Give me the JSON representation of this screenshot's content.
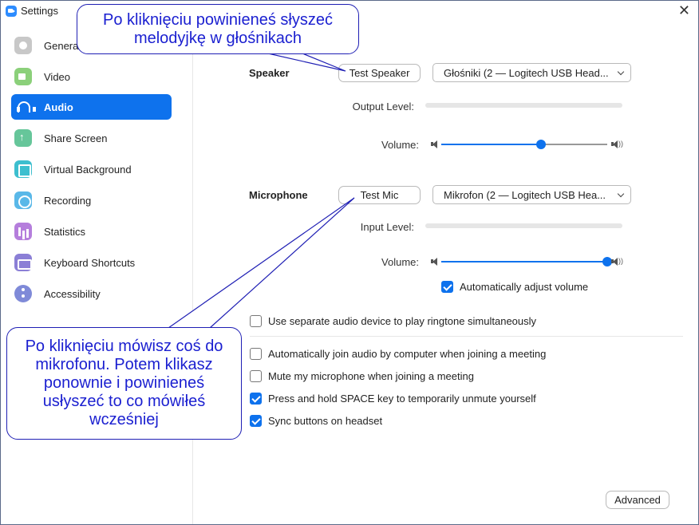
{
  "window": {
    "title": "Settings",
    "close": "✕"
  },
  "sidebar": {
    "items": [
      {
        "label": "General",
        "icon": "gear-icon"
      },
      {
        "label": "Video",
        "icon": "video-icon"
      },
      {
        "label": "Audio",
        "icon": "headphones-icon",
        "active": true
      },
      {
        "label": "Share Screen",
        "icon": "share-screen-icon"
      },
      {
        "label": "Virtual Background",
        "icon": "virtual-background-icon"
      },
      {
        "label": "Recording",
        "icon": "recording-icon"
      },
      {
        "label": "Statistics",
        "icon": "statistics-icon"
      },
      {
        "label": "Keyboard Shortcuts",
        "icon": "keyboard-icon"
      },
      {
        "label": "Accessibility",
        "icon": "accessibility-icon"
      }
    ]
  },
  "speaker": {
    "label": "Speaker",
    "test_button": "Test Speaker",
    "device": "Głośniki (2 — Logitech USB Head...",
    "output_level_label": "Output Level:",
    "volume_label": "Volume:",
    "volume_fraction": 0.6
  },
  "microphone": {
    "label": "Microphone",
    "test_button": "Test Mic",
    "device": "Mikrofon (2 — Logitech USB Hea...",
    "input_level_label": "Input Level:",
    "volume_label": "Volume:",
    "volume_fraction": 1.0,
    "auto_adjust_label": "Automatically adjust volume",
    "auto_adjust_checked": true
  },
  "options": {
    "separate_ringtone": {
      "label": "Use separate audio device to play ringtone simultaneously",
      "checked": false
    },
    "auto_join": {
      "label": "Automatically join audio by computer when joining a meeting",
      "checked": false
    },
    "mute_on_join": {
      "label": "Mute my microphone when joining a meeting",
      "checked": false
    },
    "space_unmute": {
      "label": "Press and hold SPACE key to temporarily unmute yourself",
      "checked": true
    },
    "sync_headset": {
      "label": "Sync buttons on headset",
      "checked": true
    }
  },
  "advanced_button": "Advanced",
  "annotations": {
    "speaker_note": "Po kliknięciu powinieneś słyszeć melodyjkę w głośnikach",
    "mic_note": "Po kliknięciu mówisz coś do mikrofonu. Potem klikasz ponownie i powinieneś usłyszeć to co mówiłeś wcześniej"
  },
  "colors": {
    "accent": "#0e72ed",
    "callout_text": "#1a1fd0"
  }
}
